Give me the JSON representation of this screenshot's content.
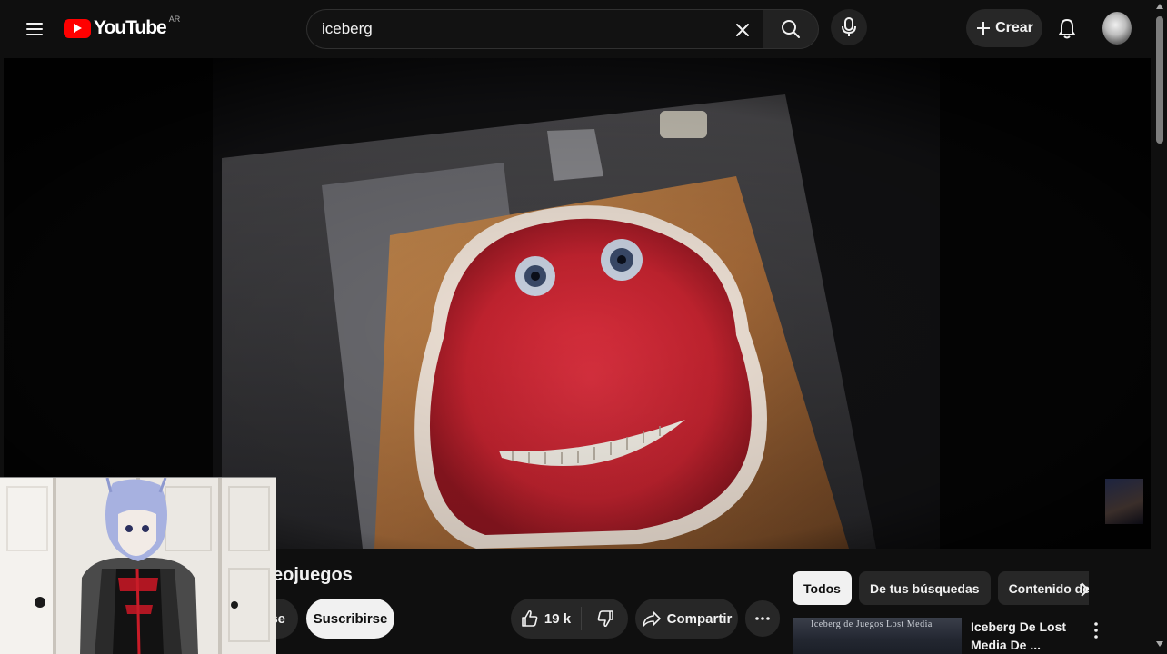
{
  "header": {
    "logo_text": "YouTube",
    "logo_region": "AR",
    "search_value": "iceberg",
    "create_label": "Crear"
  },
  "video": {
    "title_visible": "eojuegos",
    "join_label_partial": "se",
    "subscribe_label": "Suscribirse",
    "likes": "19 k",
    "share_label": "Compartir"
  },
  "chips": [
    "Todos",
    "De tus búsquedas",
    "Contenido de"
  ],
  "recommendation": {
    "thumb_text": "Iceberg de Juegos Lost Media",
    "title": "Iceberg De Lost Media De ..."
  },
  "colors": {
    "background": "#0f0f0f",
    "brand_red": "#ff0000",
    "button_bg": "#272727",
    "chip_active_bg": "#f1f1f1"
  }
}
